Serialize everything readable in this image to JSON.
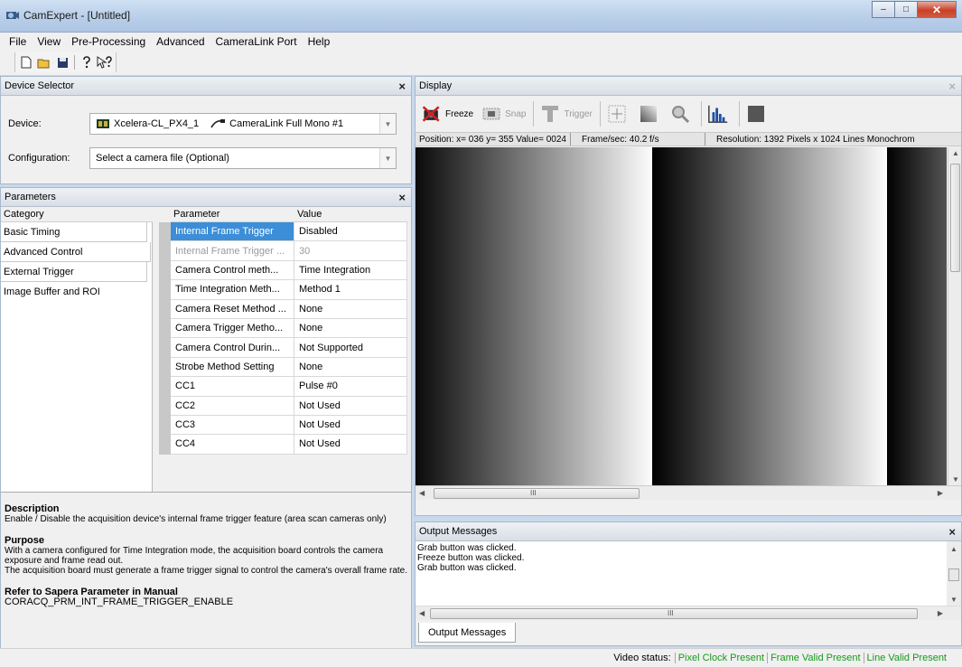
{
  "window": {
    "title": "CamExpert - [Untitled]",
    "minimize": "–",
    "maximize": "□",
    "close": "✕"
  },
  "menu": [
    "File",
    "View",
    "Pre-Processing",
    "Advanced",
    "CameraLink Port",
    "Help"
  ],
  "device_selector": {
    "title": "Device Selector",
    "device_label": "Device:",
    "device_value": "Xcelera-CL_PX4_1",
    "device_port": "CameraLink Full Mono #1",
    "config_label": "Configuration:",
    "config_value": "Select a camera file (Optional)"
  },
  "parameters": {
    "title": "Parameters",
    "col_category": "Category",
    "col_parameter": "Parameter",
    "col_value": "Value",
    "categories": [
      "Basic Timing",
      "Advanced Control",
      "External Trigger",
      "Image Buffer and ROI"
    ],
    "rows": [
      {
        "name": "Internal Frame Trigger",
        "value": "Disabled"
      },
      {
        "name": "Internal Frame Trigger ...",
        "value": "30"
      },
      {
        "name": "Camera Control meth...",
        "value": "Time Integration"
      },
      {
        "name": "Time Integration Meth...",
        "value": "Method 1"
      },
      {
        "name": "Camera Reset Method ...",
        "value": "None"
      },
      {
        "name": "Camera Trigger Metho...",
        "value": "None"
      },
      {
        "name": "Camera Control Durin...",
        "value": "Not Supported"
      },
      {
        "name": "Strobe Method Setting",
        "value": "None"
      },
      {
        "name": "CC1",
        "value": "Pulse #0"
      },
      {
        "name": "CC2",
        "value": "Not Used"
      },
      {
        "name": "CC3",
        "value": "Not Used"
      },
      {
        "name": "CC4",
        "value": "Not Used"
      }
    ]
  },
  "description": {
    "h1": "Description",
    "t1": "Enable / Disable the acquisition device's internal frame trigger feature (area scan cameras only)",
    "h2": "Purpose",
    "t2a": "With a camera configured for Time Integration mode, the acquisition board controls the camera exposure and frame read out.",
    "t2b": "The acquisition board must generate a frame trigger signal to control the camera's overall frame rate.",
    "h3": "Refer to Sapera Parameter in Manual",
    "t3": "CORACQ_PRM_INT_FRAME_TRIGGER_ENABLE"
  },
  "display": {
    "title": "Display",
    "freeze": "Freeze",
    "snap": "Snap",
    "trigger": "Trigger",
    "status_position": "Position: x= 036 y= 355 Value= 0024",
    "status_fps": "Frame/sec: 40.2 f/s",
    "status_resolution": "Resolution: 1392 Pixels x 1024 Lines  Monochrom"
  },
  "output": {
    "title": "Output Messages",
    "messages": [
      "Grab button was clicked.",
      "Freeze button was clicked.",
      "Grab button was clicked."
    ],
    "tab": "Output Messages"
  },
  "statusbar": {
    "label": "Video status:",
    "items": [
      "Pixel Clock Present",
      "Frame Valid Present",
      "Line Valid Present"
    ]
  },
  "scroll_glyph": "III",
  "colors": {
    "selection": "#3c8ed8",
    "status_green": "#159a1a"
  }
}
